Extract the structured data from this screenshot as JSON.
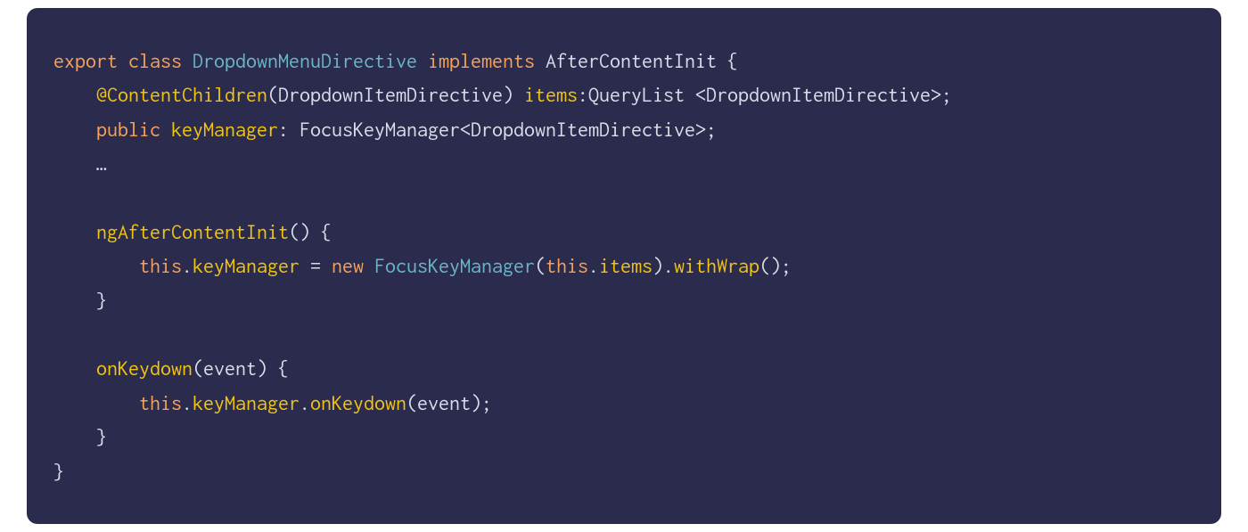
{
  "code": {
    "line1": {
      "export": "export",
      "class": "class",
      "classname": "DropdownMenuDirective",
      "implements": "implements",
      "interface": "AfterContentInit",
      "brace": "{"
    },
    "line2": {
      "indent": "    ",
      "decorator": "@ContentChildren",
      "lparen": "(",
      "arg": "DropdownItemDirective",
      "rparen": ")",
      "prop": "items",
      "colon": ":",
      "type1": "QueryList",
      "space": " ",
      "lt": "<",
      "type2": "DropdownItemDirective",
      "gt": ">",
      "semi": ";"
    },
    "line3": {
      "indent": "    ",
      "public": "public",
      "prop": "keyManager",
      "colon": ":",
      "type1": "FocusKeyManager",
      "lt": "<",
      "type2": "DropdownItemDirective",
      "gt": ">",
      "semi": ";"
    },
    "line4": {
      "indent": "    ",
      "ellipsis": "…"
    },
    "line6": {
      "indent": "    ",
      "method": "ngAfterContentInit",
      "parens": "()",
      "brace": "{"
    },
    "line7": {
      "indent": "        ",
      "this": "this",
      "dot1": ".",
      "prop": "keyManager",
      "eq": " = ",
      "new": "new",
      "ctor": "FocusKeyManager",
      "lparen": "(",
      "this2": "this",
      "dot2": ".",
      "prop2": "items",
      "rparen": ")",
      "dot3": ".",
      "method": "withWrap",
      "parens2": "()",
      "semi": ";"
    },
    "line8": {
      "indent": "    ",
      "brace": "}"
    },
    "line10": {
      "indent": "    ",
      "method": "onKeydown",
      "lparen": "(",
      "param": "event",
      "rparen": ")",
      "brace": "{"
    },
    "line11": {
      "indent": "        ",
      "this": "this",
      "dot1": ".",
      "prop": "keyManager",
      "dot2": ".",
      "method": "onKeydown",
      "lparen": "(",
      "param": "event",
      "rparen": ")",
      "semi": ";"
    },
    "line12": {
      "indent": "    ",
      "brace": "}"
    },
    "line13": {
      "brace": "}"
    }
  }
}
